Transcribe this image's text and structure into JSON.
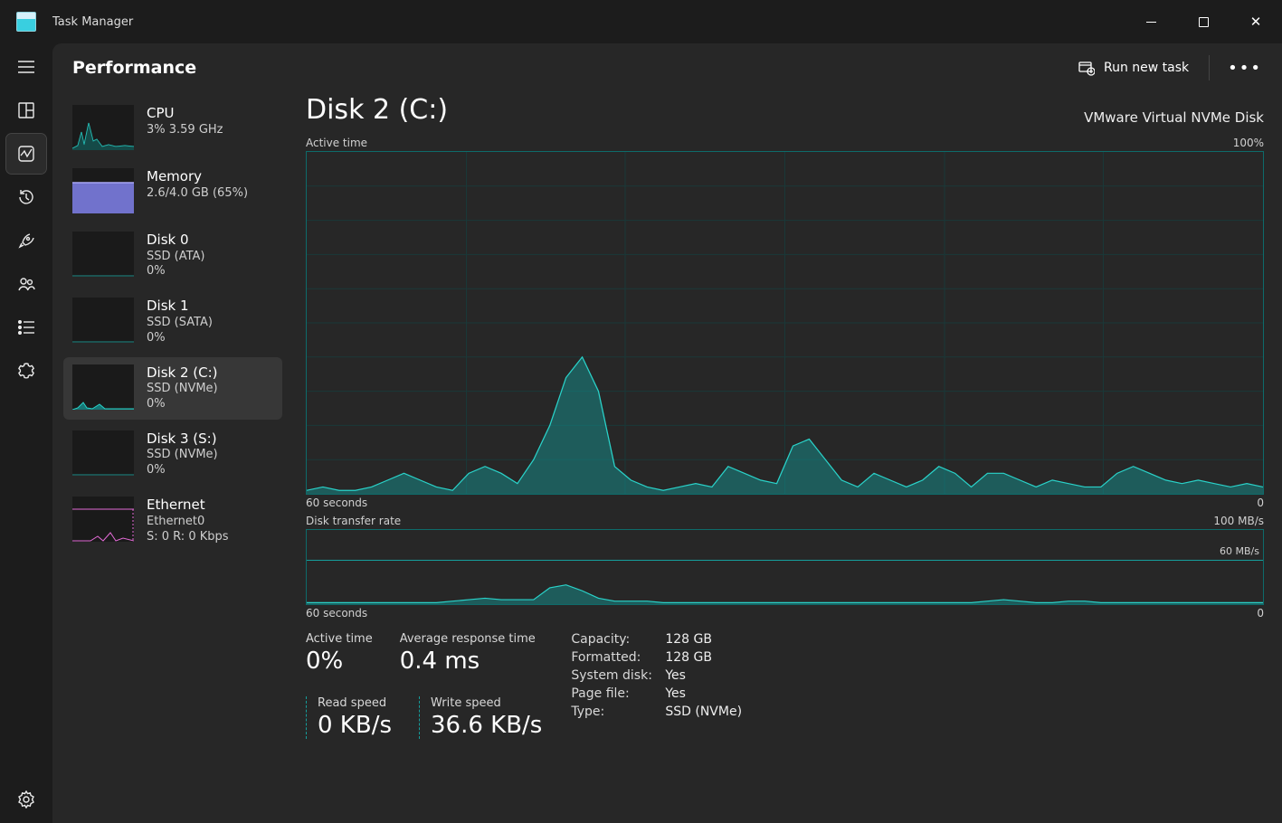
{
  "app": {
    "title": "Task Manager"
  },
  "header": {
    "tab": "Performance",
    "run_new_task": "Run new task"
  },
  "sidebar": {
    "items": [
      {
        "name": "CPU",
        "line1": "3%  3.59 GHz",
        "line2": "",
        "kind": "cpu"
      },
      {
        "name": "Memory",
        "line1": "2.6/4.0 GB (65%)",
        "line2": "",
        "kind": "mem"
      },
      {
        "name": "Disk 0",
        "line1": "SSD (ATA)",
        "line2": "0%",
        "kind": "disk"
      },
      {
        "name": "Disk 1",
        "line1": "SSD (SATA)",
        "line2": "0%",
        "kind": "disk"
      },
      {
        "name": "Disk 2 (C:)",
        "line1": "SSD (NVMe)",
        "line2": "0%",
        "kind": "disk",
        "selected": true
      },
      {
        "name": "Disk 3 (S:)",
        "line1": "SSD (NVMe)",
        "line2": "0%",
        "kind": "disk"
      },
      {
        "name": "Ethernet",
        "line1": "Ethernet0",
        "line2": "S: 0 R: 0 Kbps",
        "kind": "net"
      }
    ]
  },
  "main": {
    "title": "Disk 2 (C:)",
    "subtitle": "VMware Virtual NVMe Disk",
    "chart1": {
      "label": "Active time",
      "max": "100%",
      "x_left": "60 seconds",
      "x_right": "0"
    },
    "chart2": {
      "label": "Disk transfer rate",
      "max": "100 MB/s",
      "mid": "60 MB/s",
      "x_left": "60 seconds",
      "x_right": "0"
    },
    "stats_top": {
      "active_time_label": "Active time",
      "active_time_val": "0%",
      "avg_resp_label": "Average response time",
      "avg_resp_val": "0.4 ms"
    },
    "stats_bottom": {
      "read_label": "Read speed",
      "read_val": "0 KB/s",
      "write_label": "Write speed",
      "write_val": "36.6 KB/s"
    },
    "kv": {
      "capacity_k": "Capacity:",
      "capacity_v": "128 GB",
      "formatted_k": "Formatted:",
      "formatted_v": "128 GB",
      "systemdisk_k": "System disk:",
      "systemdisk_v": "Yes",
      "pagefile_k": "Page file:",
      "pagefile_v": "Yes",
      "type_k": "Type:",
      "type_v": "SSD (NVMe)"
    }
  },
  "chart_data": [
    {
      "type": "area",
      "title": "Active time",
      "ylabel": "Active time (%)",
      "ylim": [
        0,
        100
      ],
      "xlabel": "seconds ago",
      "xlim": [
        60,
        0
      ],
      "values_pct": [
        1,
        2,
        1,
        1,
        2,
        4,
        6,
        4,
        2,
        1,
        6,
        8,
        6,
        3,
        10,
        20,
        34,
        40,
        30,
        8,
        4,
        2,
        1,
        2,
        3,
        2,
        8,
        6,
        4,
        3,
        14,
        16,
        10,
        4,
        2,
        6,
        4,
        2,
        4,
        8,
        6,
        2,
        6,
        6,
        4,
        2,
        4,
        3,
        2,
        2,
        6,
        8,
        6,
        4,
        3,
        4,
        3,
        2,
        3,
        2
      ]
    },
    {
      "type": "area",
      "title": "Disk transfer rate",
      "ylabel": "MB/s",
      "ylim": [
        0,
        100
      ],
      "xlabel": "seconds ago",
      "xlim": [
        60,
        0
      ],
      "series": [
        {
          "name": "write_mbps",
          "values": [
            2,
            2,
            2,
            2,
            2,
            2,
            2,
            2,
            2,
            4,
            6,
            8,
            6,
            6,
            6,
            22,
            26,
            18,
            8,
            4,
            4,
            4,
            2,
            2,
            2,
            2,
            2,
            2,
            2,
            2,
            2,
            2,
            2,
            2,
            2,
            2,
            2,
            2,
            2,
            2,
            2,
            2,
            4,
            6,
            4,
            2,
            2,
            4,
            4,
            2,
            2,
            2,
            2,
            2,
            2,
            2,
            2,
            2,
            2,
            2
          ]
        },
        {
          "name": "read_mbps",
          "values": [
            0,
            0,
            0,
            0,
            0,
            0,
            0,
            0,
            0,
            0,
            0,
            0,
            0,
            0,
            0,
            0,
            0,
            0,
            0,
            0,
            0,
            0,
            0,
            0,
            0,
            0,
            0,
            0,
            0,
            0,
            0,
            0,
            0,
            0,
            0,
            0,
            0,
            0,
            0,
            0,
            0,
            0,
            0,
            0,
            0,
            0,
            0,
            0,
            0,
            0,
            0,
            0,
            0,
            0,
            0,
            0,
            0,
            0,
            0,
            0
          ]
        }
      ],
      "reference_lines": [
        60
      ]
    }
  ]
}
